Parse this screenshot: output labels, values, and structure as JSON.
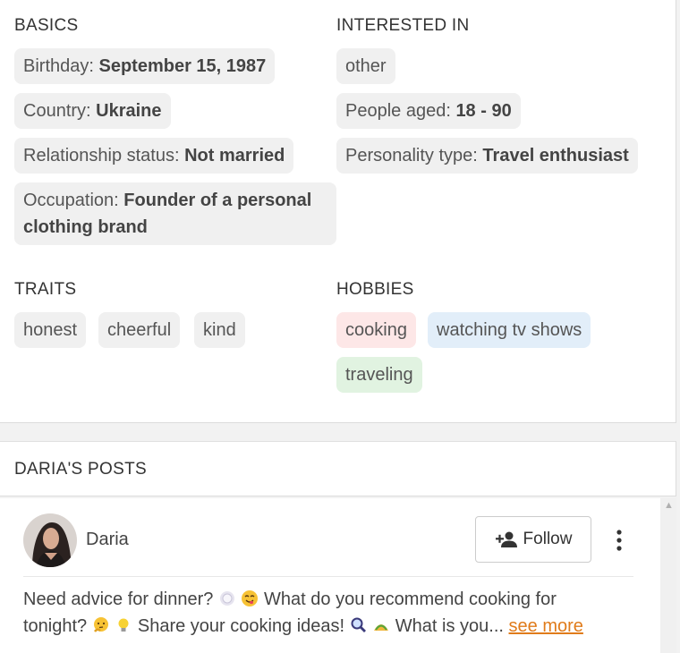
{
  "basics": {
    "title": "BASICS",
    "birthday_label": "Birthday: ",
    "birthday_value": "September 15, 1987",
    "country_label": "Country: ",
    "country_value": "Ukraine",
    "relationship_label": "Relationship status: ",
    "relationship_value": "Not married",
    "occupation_label": "Occupation: ",
    "occupation_value": "Founder of a personal clothing brand"
  },
  "interested": {
    "title": "INTERESTED IN",
    "gender": "other",
    "age_label": "People aged: ",
    "age_value": "18 - 90",
    "personality_label": "Personality type: ",
    "personality_value": "Travel enthusiast"
  },
  "traits": {
    "title": "TRAITS",
    "items": [
      "honest",
      "cheerful",
      "kind"
    ]
  },
  "hobbies": {
    "title": "HOBBIES",
    "items": [
      "cooking",
      "watching tv shows",
      "traveling"
    ],
    "colors": [
      "#fde7e7",
      "#e2eef9",
      "#e1f3e1"
    ]
  },
  "posts": {
    "title": "DARIA'S POSTS"
  },
  "post": {
    "author": "Daria",
    "follow_label": "Follow",
    "text_1": "Need advice for dinner?",
    "text_2": "What do you recommend cooking for",
    "text_3": "tonight?",
    "text_4": "Share your cooking ideas!",
    "text_5": "What is you...",
    "see_more": "see more",
    "emojis": [
      "plate-icon",
      "yum-face-icon",
      "thinking-face-icon",
      "lightbulb-icon",
      "magnifier-icon",
      "taco-icon"
    ]
  },
  "accent": "#e07b1a"
}
